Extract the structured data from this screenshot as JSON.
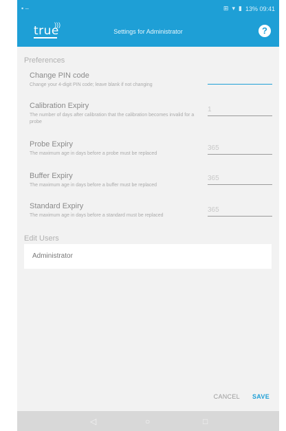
{
  "status_bar": {
    "left_icons": [
      "battery-icon",
      "notification-icon"
    ],
    "right_text": "13% 09:41",
    "right_icons": [
      "vibrate-icon",
      "wifi-icon",
      "battery-icon"
    ]
  },
  "app_bar": {
    "logo_text": "true",
    "title": "Settings for Administrator",
    "help_icon": "?"
  },
  "preferences": {
    "header": "Preferences",
    "items": [
      {
        "title": "Change PIN code",
        "subtitle": "Change your 4-digit PIN code; leave blank if not changing",
        "value": ""
      },
      {
        "title": "Calibration Expiry",
        "subtitle": "The number of days after calibration that the calibration becomes invalid for a probe",
        "value": "1"
      },
      {
        "title": "Probe Expiry",
        "subtitle": "The maximum age in days before a probe must be replaced",
        "value": "365"
      },
      {
        "title": "Buffer Expiry",
        "subtitle": "The maximum age in days before a buffer must be replaced",
        "value": "365"
      },
      {
        "title": "Standard Expiry",
        "subtitle": "The maximum age in days before a standard must be replaced",
        "value": "365"
      }
    ]
  },
  "edit_users": {
    "header": "Edit Users",
    "users": [
      "Administrator"
    ]
  },
  "actions": {
    "cancel": "CANCEL",
    "save": "SAVE"
  },
  "nav_bar": {
    "back": "◁",
    "home": "○",
    "recent": "□"
  },
  "colors": {
    "accent": "#1e9fd6",
    "background": "#f2f2f2"
  }
}
